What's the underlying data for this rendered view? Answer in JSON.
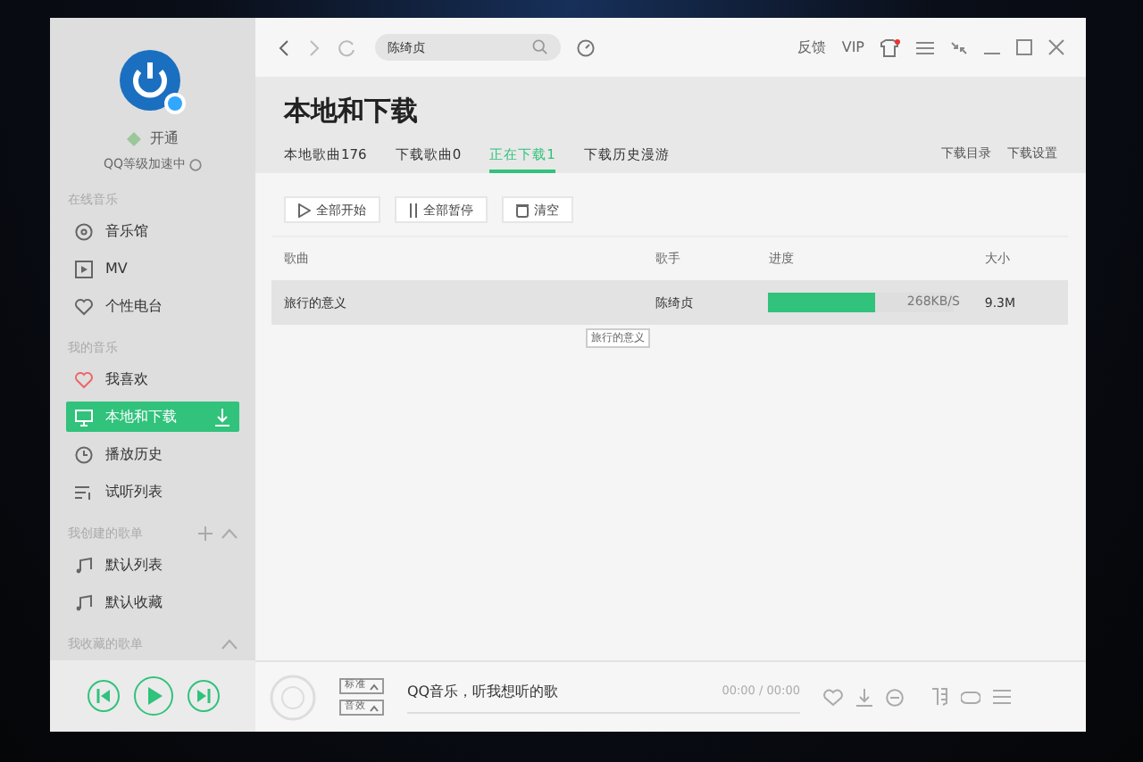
{
  "sidebar": {
    "vip_label": "开通",
    "level_text": "QQ等级加速中",
    "sections": [
      {
        "title": "在线音乐",
        "items": [
          {
            "label": "音乐馆",
            "selected": false
          },
          {
            "label": "MV",
            "selected": false
          },
          {
            "label": "个性电台",
            "selected": false
          }
        ]
      },
      {
        "title": "我的音乐",
        "items": [
          {
            "label": "我喜欢",
            "selected": false
          },
          {
            "label": "本地和下载",
            "selected": true
          },
          {
            "label": "播放历史",
            "selected": false
          },
          {
            "label": "试听列表",
            "selected": false
          }
        ]
      },
      {
        "title": "我创建的歌单",
        "items": [
          {
            "label": "默认列表",
            "selected": false
          },
          {
            "label": "默认收藏",
            "selected": false
          }
        ]
      },
      {
        "title": "我收藏的歌单"
      }
    ]
  },
  "topbar": {
    "search": "陈绮贞",
    "links": [
      "反馈",
      "VIP"
    ]
  },
  "header": {
    "title": "本地和下载",
    "tabs": [
      {
        "label": "本地歌曲176",
        "selected": false
      },
      {
        "label": "下载歌曲0",
        "selected": false
      },
      {
        "label": "正在下载1",
        "selected": true
      },
      {
        "label": "下载历史漫游",
        "selected": false
      }
    ],
    "links": [
      "下载目录",
      "下载设置"
    ]
  },
  "toolbar": [
    "全部开始",
    "全部暂停",
    "清空"
  ],
  "table": {
    "columns": [
      "歌曲",
      "歌手",
      "进度",
      "大小"
    ],
    "rows": [
      {
        "song": "旅行的意义",
        "singer": "陈绮贞",
        "level": 0.57,
        "speed": "268KB/S",
        "size": "9.3M",
        "selected": true
      }
    ]
  },
  "tooltip": "旅行的意义",
  "player": {
    "quality": "标准",
    "effect": "音效",
    "song": "QQ音乐，听我想听的歌",
    "time": "00:00 / 00:00"
  }
}
